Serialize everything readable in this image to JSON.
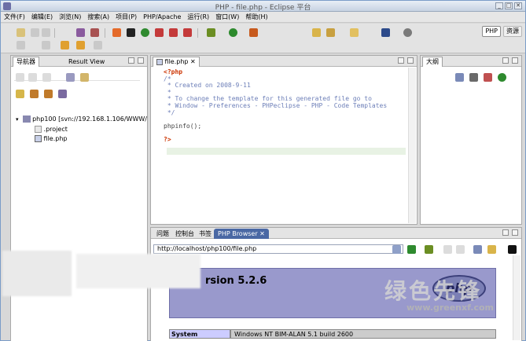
{
  "window": {
    "title": "PHP - file.php - Eclipse 平台",
    "controls": [
      "_",
      "□",
      "✕"
    ]
  },
  "menu": [
    "文件(F)",
    "编辑(E)",
    "浏览(N)",
    "搜索(A)",
    "项目(P)",
    "PHP/Apache",
    "运行(R)",
    "窗口(W)",
    "帮助(H)"
  ],
  "perspectives": [
    {
      "label": "PHP",
      "active": true
    },
    {
      "label": "资源",
      "active": false
    }
  ],
  "navigator": {
    "tabs": [
      "导航器",
      "Result View"
    ],
    "tree": [
      {
        "label": "php100 [svn://192.168.1.106/WWW/",
        "level": 0,
        "icon": "project-icon"
      },
      {
        "label": ".project",
        "level": 1,
        "icon": "file-icon"
      },
      {
        "label": "file.php",
        "level": 1,
        "icon": "php-file-icon"
      }
    ]
  },
  "editor": {
    "tab": "file.php",
    "lines": [
      {
        "text": "<?php",
        "cls": "kw"
      },
      {
        "text": "/*",
        "cls": "cm"
      },
      {
        "text": " * Created on 2008-9-11",
        "cls": "cm"
      },
      {
        "text": " *",
        "cls": "cm"
      },
      {
        "text": " * To change the template for this generated file go to",
        "cls": "cm"
      },
      {
        "text": " * Window - Preferences - PHPeclipse - PHP - Code Templates",
        "cls": "cm"
      },
      {
        "text": " */",
        "cls": "cm"
      },
      {
        "text": "",
        "cls": "fn"
      },
      {
        "text": "phpinfo();",
        "cls": "fn"
      },
      {
        "text": "",
        "cls": "fn"
      },
      {
        "text": "?>",
        "cls": "kw"
      }
    ]
  },
  "outline": {
    "tab": "大纲"
  },
  "bottom": {
    "tabs": [
      "问题",
      "控制台",
      "书签",
      "PHP Browser"
    ],
    "url": "http://localhost/php100/file.php",
    "php_version": "rsion 5.2.6",
    "system_label": "System",
    "system_value": "Windows NT BIM-ALAN 5.1 build 2600"
  },
  "watermark": {
    "text": "绿色先锋",
    "url": "www.greenxf.com"
  }
}
